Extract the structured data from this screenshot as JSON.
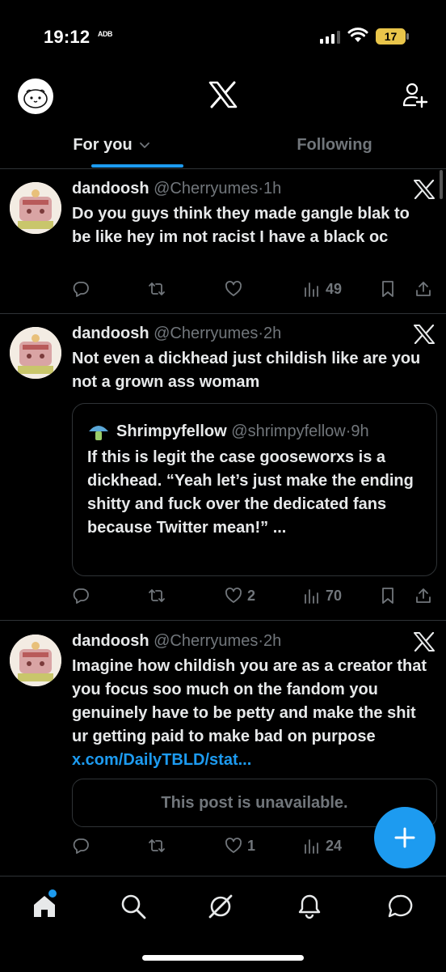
{
  "status": {
    "time": "19:12",
    "extra": "ᴬᴰᴮ",
    "battery": "17"
  },
  "header": {
    "logo": "x-logo",
    "follow_icon": "add-user-icon"
  },
  "tabs": [
    {
      "label": "For you",
      "selected": true
    },
    {
      "label": "Following",
      "selected": false
    }
  ],
  "tweets": [
    {
      "name": "dandoosh",
      "handle": "@Cherryumes",
      "sep": "·",
      "time": "1h",
      "text": "Do you guys think they made gangle blak to be like hey im not racist I have a black oc",
      "likes": "",
      "retweets": "",
      "replies": "",
      "views": "49"
    },
    {
      "name": "dandoosh",
      "handle": "@Cherryumes",
      "sep": "·",
      "time": "2h",
      "text": "Not even a dickhead just childish like are you not a grown ass womam",
      "quote": {
        "name": "Shrimpyfellow",
        "handle": "@shrimpyfellow",
        "sep": "·",
        "time": "9h",
        "text": "If this is legit the case gooseworxs is a dickhead. “Yeah let’s just make the ending shitty and fuck over the dedicated fans because Twitter mean!” ..."
      },
      "likes": "2",
      "retweets": "",
      "replies": "",
      "views": "70"
    },
    {
      "name": "dandoosh",
      "handle": "@Cherryumes",
      "sep": "·",
      "time": "2h",
      "text": "Imagine how childish you are as a creator that you focus soo much on the fandom you genuinely have to be petty and make the shit ur getting paid to make bad on purpose",
      "link": "x.com/DailyTBLD/stat...",
      "unavailable": "This post is unavailable.",
      "likes": "1",
      "retweets": "",
      "replies": "",
      "views": "24"
    }
  ],
  "fab": {
    "icon": "plus-icon"
  },
  "nav": [
    "home-icon",
    "search-icon",
    "grok-icon",
    "notifications-icon",
    "messages-icon"
  ],
  "colors": {
    "accent": "#1d9bf0",
    "muted": "#71767b",
    "text": "#e7e9ea",
    "border": "#2f3336"
  }
}
